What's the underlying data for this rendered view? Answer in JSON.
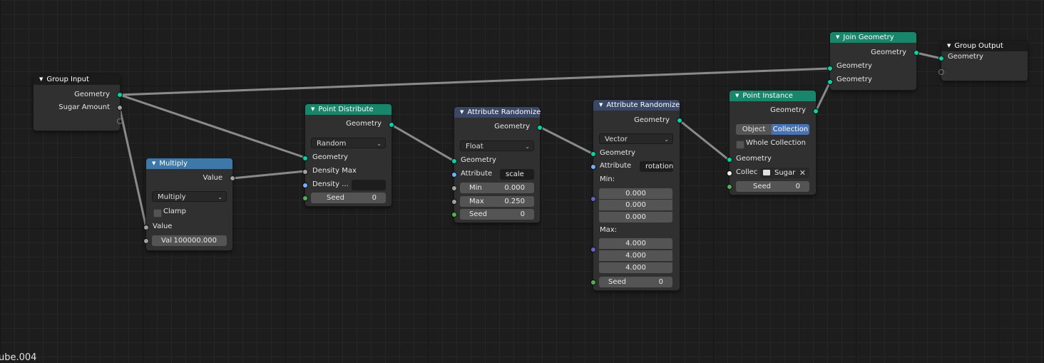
{
  "corner_text": "ube.004",
  "nodes": {
    "group_input": {
      "title": "Group Input",
      "outputs": [
        "Geometry",
        "Sugar Amount"
      ]
    },
    "multiply": {
      "title": "Multiply",
      "output": "Value",
      "operation": "Multiply",
      "clamp_label": "Clamp",
      "input_label": "Value",
      "val_label": "Val",
      "val_value": "100000.000"
    },
    "point_distribute": {
      "title": "Point Distribute",
      "output": "Geometry",
      "mode": "Random",
      "inputs": [
        "Geometry",
        "Density Max",
        "Density ..."
      ],
      "density_attr_value": "",
      "seed_label": "Seed",
      "seed_value": "0"
    },
    "attr_randomize_1": {
      "title": "Attribute Randomize",
      "output": "Geometry",
      "type": "Float",
      "geometry_label": "Geometry",
      "attribute_label": "Attribute",
      "attribute_value": "scale",
      "min_label": "Min",
      "min_value": "0.000",
      "max_label": "Max",
      "max_value": "0.250",
      "seed_label": "Seed",
      "seed_value": "0"
    },
    "attr_randomize_2": {
      "title": "Attribute Randomize",
      "output": "Geometry",
      "type": "Vector",
      "geometry_label": "Geometry",
      "attribute_label": "Attribute",
      "attribute_value": "rotation",
      "min_label": "Min:",
      "min_values": [
        "0.000",
        "0.000",
        "0.000"
      ],
      "max_label": "Max:",
      "max_values": [
        "4.000",
        "4.000",
        "4.000"
      ],
      "seed_label": "Seed",
      "seed_value": "0"
    },
    "point_instance": {
      "title": "Point Instance",
      "output": "Geometry",
      "mode_object": "Object",
      "mode_collection": "Collection",
      "whole_collection_label": "Whole Collection",
      "geometry_label": "Geometry",
      "collection_label": "Collec",
      "collection_value": "Sugar",
      "seed_label": "Seed",
      "seed_value": "0"
    },
    "join_geometry": {
      "title": "Join Geometry",
      "output": "Geometry",
      "inputs": [
        "Geometry",
        "Geometry"
      ]
    },
    "group_output": {
      "title": "Group Output",
      "input": "Geometry"
    }
  },
  "colors": {
    "geometry_socket": "#00d6a3",
    "value_socket": "#a1a1a1",
    "vector_socket": "#6363c7",
    "string_socket": "#70b2ff",
    "integer_socket": "#4fb34f",
    "geometry_header": "#17866a",
    "math_header": "#3d78a8",
    "attribute_header": "#3a4865",
    "selected_toggle": "#4772b3"
  }
}
